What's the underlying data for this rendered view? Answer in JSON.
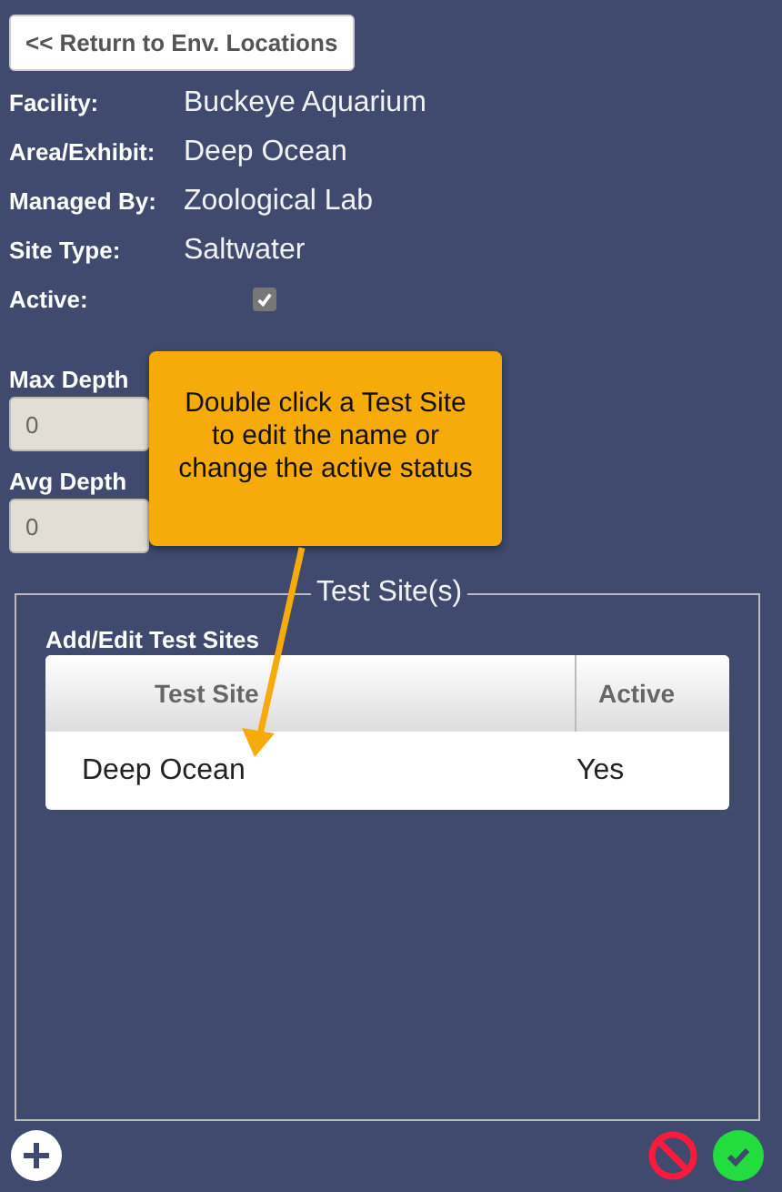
{
  "back_button": "<< Return to Env. Locations",
  "details": [
    {
      "label": "Facility:",
      "value": "Buckeye Aquarium"
    },
    {
      "label": "Area/Exhibit:",
      "value": "Deep Ocean"
    },
    {
      "label": "Managed By:",
      "value": "Zoological Lab"
    },
    {
      "label": "Site Type:",
      "value": "Saltwater"
    }
  ],
  "active": {
    "label": "Active:",
    "checked": true
  },
  "depth_fields": [
    {
      "label": "Max Depth",
      "value": "0"
    },
    {
      "label": "Avg Depth",
      "value": "0"
    }
  ],
  "callout": {
    "text": "Double click a Test Site to edit the name or change the active status"
  },
  "test_sites": {
    "legend": "Test Site(s)",
    "title": "Add/Edit Test Sites",
    "columns": [
      "Test Site",
      "Active"
    ],
    "rows": [
      {
        "site": "Deep Ocean",
        "active": "Yes"
      }
    ]
  }
}
